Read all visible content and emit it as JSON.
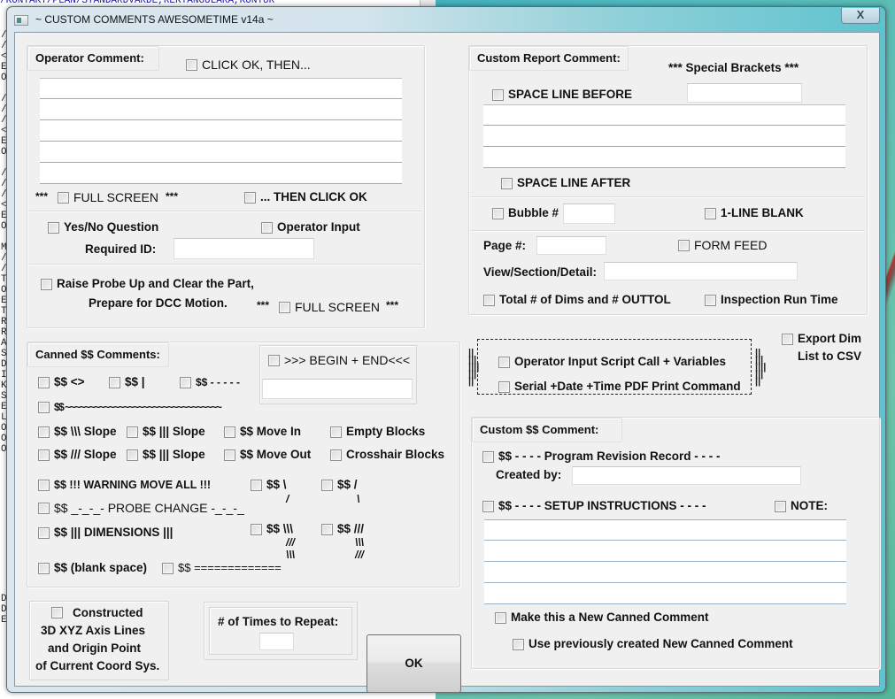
{
  "background": {
    "editor_first_line": "/KONTAKT/PLAN/STANDARDVARDE,REKTANGULARA,KONTUR",
    "gutter_chars": [
      "/",
      "/",
      "<",
      "E",
      "O",
      "/",
      "/",
      "/",
      "<",
      "E",
      "O",
      "/",
      "/",
      "/",
      "<",
      "E",
      "O",
      "M",
      "/",
      "/",
      "T",
      "O",
      "E",
      "T",
      "R",
      "R",
      "A",
      "S",
      "D",
      "I",
      "K",
      "S",
      "E",
      "L",
      "O",
      "O",
      "O",
      "D",
      "D",
      "E"
    ]
  },
  "window": {
    "title": "~ CUSTOM COMMENTS AWESOMETIME v14a ~",
    "close_label": "X"
  },
  "operator_comment": {
    "title": "Operator Comment:",
    "click_ok_then": "CLICK OK, THEN...",
    "lines": [
      "",
      "",
      "",
      "",
      ""
    ],
    "stars_left": "***",
    "full_screen": "FULL SCREEN",
    "stars_right": "***",
    "then_click_ok": "... THEN CLICK OK",
    "yes_no_question": "Yes/No Question",
    "operator_input": "Operator Input",
    "required_id_label": "Required ID:",
    "required_id_value": "",
    "raise_probe_line1": "Raise Probe Up and Clear the Part,",
    "raise_probe_line2": "Prepare for DCC Motion.",
    "full_screen_2": "FULL SCREEN"
  },
  "custom_report": {
    "title": "Custom Report Comment:",
    "special_brackets": "*** Special Brackets ***",
    "special_brackets_value": "",
    "space_line_before": "SPACE LINE BEFORE",
    "lines": [
      "",
      "",
      ""
    ],
    "space_line_after": "SPACE LINE AFTER",
    "bubble_label": "Bubble #",
    "bubble_value": "",
    "one_line_blank": "1-LINE BLANK",
    "page_label": "Page #:",
    "page_value": "",
    "form_feed": "FORM FEED",
    "view_section_label": "View/Section/Detail:",
    "view_section_value": "",
    "total_dims": "Total # of Dims and # OUTTOL",
    "inspection_run_time": "Inspection Run Time"
  },
  "canned": {
    "title": "Canned $$ Comments:",
    "begin_end": ">>> BEGIN + END<<<",
    "begin_end_value": "",
    "items": {
      "angle": "$$ <>",
      "pipe": "$$ |",
      "dashes": "$$ - - - - -",
      "tilde": "$$ ~~~~~~~~~~~~~~~~~~~~~~~~~~~~~~~~",
      "back_slope": "$$ \\\\\\ Slope",
      "pipe_slope_1": "$$ ||| Slope",
      "move_in": "$$ Move In",
      "empty_blocks": "Empty Blocks",
      "fwd_slope": "$$ /// Slope",
      "pipe_slope_2": "$$ ||| Slope",
      "move_out": "$$ Move Out",
      "crosshair_blocks": "Crosshair Blocks",
      "warning": "$$ !!! WARNING MOVE ALL !!!",
      "backslash_single": "$$ \\",
      "backslash_single_2": "/",
      "slash_single": "$$ /",
      "slash_single_2": "\\",
      "probe_change": "$$ _-_-_- PROBE CHANGE -_-_-_",
      "dimensions": "$$ ||| DIMENSIONS |||",
      "triple_back": "$$ \\\\\\",
      "triple_back_2": "///",
      "triple_back_3": "\\\\\\",
      "triple_fwd": "$$ ///",
      "triple_fwd_2": "\\\\\\",
      "triple_fwd_3": "///",
      "blank_space": "$$ (blank space)",
      "equals": "$$ ============="
    }
  },
  "script_box": {
    "operator_input_script": "Operator Input Script Call + Variables",
    "serial_date_time": "Serial +Date +Time PDF Print Command"
  },
  "export": {
    "line1": "Export Dim",
    "line2": "List to CSV"
  },
  "custom_dollar": {
    "title": "Custom $$ Comment:",
    "program_revision": "$$ - - - - Program Revision Record - - - -",
    "created_by_label": "Created by:",
    "created_by_value": "",
    "setup_instructions": "$$ - - - - SETUP INSTRUCTIONS - - - -",
    "note": "NOTE:",
    "lines": [
      "",
      "",
      "",
      ""
    ],
    "make_new_canned": "Make this a New Canned Comment",
    "use_previous_canned": "Use previously created New Canned Comment"
  },
  "bottom": {
    "constructed_line1": "Constructed",
    "constructed_line2": "3D XYZ Axis Lines",
    "constructed_line3": "and Origin Point",
    "constructed_line4": "of Current Coord Sys.",
    "repeat_label": "# of Times to Repeat:",
    "repeat_value": "",
    "ok_label": "OK"
  }
}
